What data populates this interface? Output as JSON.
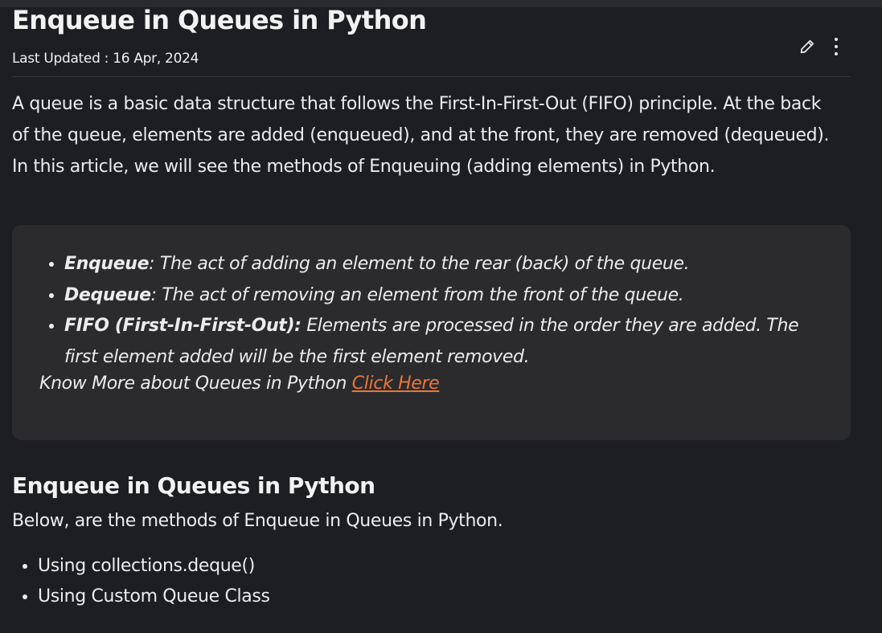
{
  "article": {
    "title": "Enqueue in Queues in Python",
    "last_updated": "Last Updated : 16 Apr, 2024",
    "actions": {
      "edit_icon": "pencil-icon",
      "more_icon": "kebab-menu-icon"
    },
    "intro": "A queue is a basic data structure that follows the First-In-First-Out (FIFO) principle. At the back of the queue, elements are added (enqueued), and at the front, they are removed (dequeued). In this article, we will see the methods of Enqueuing (adding elements) in Python.",
    "note": {
      "items": [
        {
          "term": "Enqueue",
          "text": ": The act of adding an element to the rear (back) of the queue."
        },
        {
          "term": "Dequeue",
          "text": ": The act of removing an element from the front of the queue."
        },
        {
          "term": "FIFO (First-In-First-Out):",
          "text": " Elements are processed in the order they are added. The first element added will be the first element removed."
        }
      ],
      "know_more_text": "Know More about Queues in Python ",
      "know_more_link": "Click Here"
    },
    "section": {
      "heading": "Enqueue in Queues in Python",
      "subtext": "Below, are the methods of Enqueue in Queues in Python.",
      "methods": [
        "Using collections.deque()",
        "Using Custom Queue Class"
      ]
    }
  },
  "colors": {
    "background": "#1d1e22",
    "note_background": "#2b2b2d",
    "link": "#e8763a",
    "text": "#ececec"
  }
}
